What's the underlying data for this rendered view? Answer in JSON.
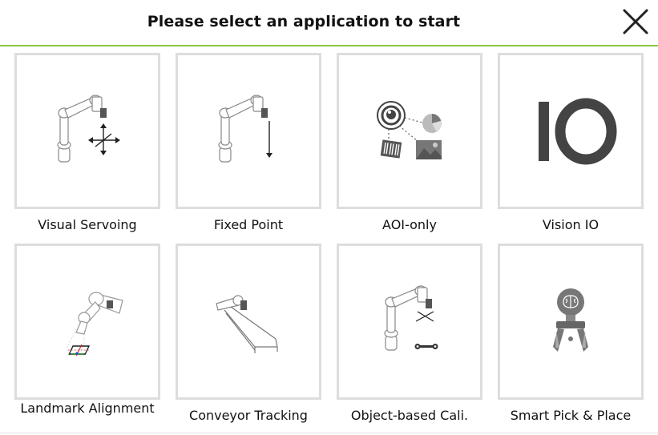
{
  "header": {
    "title": "Please select an application to start",
    "accent_color": "#8dc63f"
  },
  "close": {
    "icon": "close-icon"
  },
  "apps": [
    {
      "label": "Visual Servoing",
      "icon": "robot-arm-move-icon"
    },
    {
      "label": "Fixed Point",
      "icon": "robot-arm-fixed-point-icon"
    },
    {
      "label": "AOI-only",
      "icon": "aoi-camera-icon"
    },
    {
      "label": "Vision IO",
      "icon": "vision-io-icon",
      "icon_text": "IO"
    },
    {
      "label": "Landmark Alignment",
      "icon": "landmark-alignment-icon"
    },
    {
      "label": "Conveyor Tracking",
      "icon": "conveyor-icon"
    },
    {
      "label": "Object-based Cali.",
      "icon": "object-calibration-icon"
    },
    {
      "label": "Smart Pick & Place",
      "icon": "smart-gripper-icon"
    }
  ]
}
